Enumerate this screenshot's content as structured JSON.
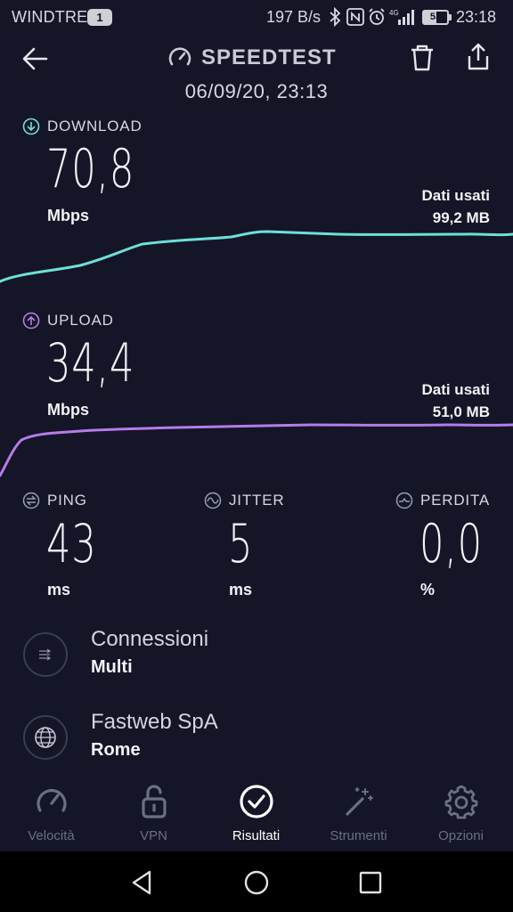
{
  "status_bar": {
    "carrier": "WINDTRE",
    "sim_slot": "1",
    "net_speed": "197 B/s",
    "battery": "53",
    "time": "23:18"
  },
  "header": {
    "title": "SPEEDTEST",
    "date": "06/09/20, 23:13"
  },
  "download": {
    "label": "DOWNLOAD",
    "value": "70,8",
    "unit": "Mbps",
    "data_used_label": "Dati usati",
    "data_used_value": "99,2 MB",
    "color": "#6de0d8"
  },
  "upload": {
    "label": "UPLOAD",
    "value": "34,4",
    "unit": "Mbps",
    "data_used_label": "Dati usati",
    "data_used_value": "51,0 MB",
    "color": "#b77be8"
  },
  "stats": {
    "ping": {
      "label": "PING",
      "value": "43",
      "unit": "ms"
    },
    "jitter": {
      "label": "JITTER",
      "value": "5",
      "unit": "ms"
    },
    "loss": {
      "label": "PERDITA",
      "value": "0,0",
      "unit": "%"
    }
  },
  "connections": {
    "title": "Connessioni",
    "value": "Multi"
  },
  "provider": {
    "title": "Fastweb SpA",
    "value": "Rome"
  },
  "bottom_nav": [
    {
      "label": "Velocità",
      "icon": "speedometer-icon"
    },
    {
      "label": "VPN",
      "icon": "padlock-icon"
    },
    {
      "label": "Risultati",
      "icon": "check-circle-icon",
      "active": true
    },
    {
      "label": "Strumenti",
      "icon": "magic-wand-icon"
    },
    {
      "label": "Opzioni",
      "icon": "gear-icon"
    }
  ]
}
